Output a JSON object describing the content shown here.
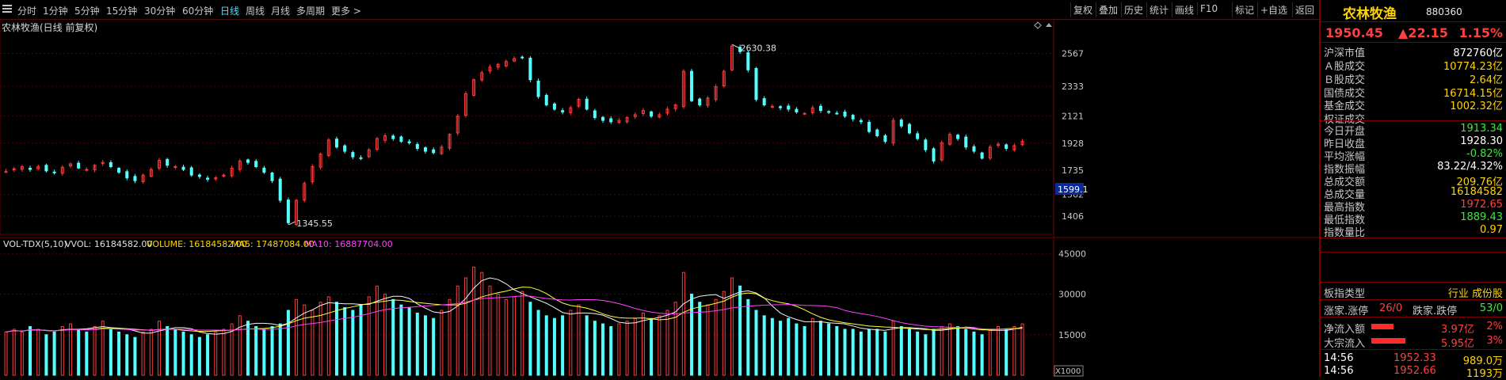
{
  "toolbar": {
    "periods": [
      "分时",
      "1分钟",
      "5分钟",
      "15分钟",
      "30分钟",
      "60分钟",
      "日线",
      "周线",
      "月线",
      "多周期",
      "更多 >"
    ],
    "active_period": "日线",
    "right_buttons": [
      "复权",
      "叠加",
      "历史",
      "统计",
      "画线",
      "F10",
      "标记",
      "+自选",
      "返回"
    ],
    "left_icon": "menu-icon"
  },
  "chart": {
    "title": "农林牧渔(日线 前复权)",
    "max_label": "2630.38",
    "min_label": "1345.55",
    "cursor_price": "1599.1",
    "price_ticks": [
      "2567",
      "2333",
      "2121",
      "1928",
      "1735",
      "1562",
      "1406"
    ],
    "vol_ticks": [
      "45000",
      "30000",
      "15000"
    ],
    "vol_unit": "X1000",
    "vol_info": {
      "name": "VOL-TDX(5,10)",
      "vvol": "VVOL: 16184582.00",
      "volume": "VOLUME: 16184582.00",
      "ma5": "MA5: 17487084.00",
      "ma10": "MA10: 16887704.00"
    },
    "colors": {
      "up": "#ff3b3b",
      "down": "#54ffff",
      "ma5": "#f4f4f4",
      "ma10": "#ffff3c",
      "ma20": "#ff40ff",
      "grid": "#5a0000"
    }
  },
  "chart_data": {
    "type": "candlestick",
    "title": "农林牧渔(日线 前复权)",
    "close_path": [
      1725,
      1745,
      1760,
      1740,
      1760,
      1730,
      1720,
      1755,
      1780,
      1750,
      1740,
      1770,
      1790,
      1760,
      1720,
      1680,
      1660,
      1700,
      1740,
      1805,
      1770,
      1760,
      1740,
      1700,
      1690,
      1670,
      1680,
      1700,
      1750,
      1800,
      1790,
      1760,
      1720,
      1660,
      1520,
      1360,
      1520,
      1640,
      1760,
      1850,
      1950,
      1900,
      1870,
      1830,
      1820,
      1880,
      1960,
      1980,
      1960,
      1940,
      1930,
      1890,
      1870,
      1860,
      1900,
      1990,
      2120,
      2280,
      2380,
      2430,
      2470,
      2490,
      2510,
      2530,
      2540,
      2380,
      2260,
      2200,
      2170,
      2150,
      2180,
      2240,
      2170,
      2110,
      2090,
      2080,
      2090,
      2110,
      2130,
      2160,
      2120,
      2130,
      2170,
      2200,
      2440,
      2230,
      2200,
      2250,
      2330,
      2440,
      2620,
      2580,
      2450,
      2240,
      2200,
      2190,
      2180,
      2170,
      2150,
      2140,
      2180,
      2160,
      2150,
      2140,
      2120,
      2100,
      2080,
      2010,
      1980,
      1940,
      2090,
      2050,
      2000,
      1960,
      1880,
      1800,
      1930,
      1990,
      1960,
      1900,
      1870,
      1820,
      1900,
      1920,
      1890,
      1910,
      1940
    ],
    "volume_path": [
      16,
      17,
      16,
      18,
      17,
      15,
      16,
      18,
      19,
      17,
      16,
      18,
      20,
      17,
      16,
      15,
      14,
      16,
      17,
      20,
      18,
      17,
      16,
      15,
      14,
      15,
      16,
      17,
      19,
      22,
      20,
      18,
      17,
      18,
      19,
      24,
      28,
      26,
      24,
      27,
      29,
      27,
      25,
      24,
      26,
      29,
      33,
      30,
      28,
      26,
      25,
      23,
      22,
      21,
      24,
      28,
      33,
      36,
      40,
      38,
      33,
      30,
      28,
      29,
      31,
      27,
      24,
      22,
      21,
      22,
      24,
      26,
      22,
      20,
      19,
      18,
      19,
      20,
      21,
      23,
      21,
      22,
      24,
      27,
      38,
      30,
      27,
      26,
      28,
      31,
      36,
      33,
      28,
      24,
      22,
      21,
      20,
      21,
      19,
      18,
      21,
      20,
      19,
      18,
      17,
      17,
      16,
      17,
      17,
      16,
      20,
      18,
      17,
      16,
      15,
      17,
      18,
      19,
      18,
      17,
      16,
      15,
      17,
      18,
      17,
      18,
      19
    ],
    "vol_ma5": 17487084.0,
    "vol_ma10": 16887704.0,
    "highest": 2630.38,
    "lowest": 1345.55,
    "ylim": [
      1345.55,
      2630.38
    ]
  },
  "side": {
    "name": "农林牧渔",
    "code": "880360",
    "price": "1950.45",
    "change": "▲22.15",
    "pct": "1.15%",
    "rows": [
      {
        "label": "沪深市值",
        "value": "872760亿",
        "cls": "white"
      },
      {
        "label": "Ａ股成交",
        "value": "10774.23亿",
        "cls": "yel"
      },
      {
        "label": "Ｂ股成交",
        "value": "2.64亿",
        "cls": "yel"
      },
      {
        "label": "国债成交",
        "value": "16714.15亿",
        "cls": "yel"
      },
      {
        "label": "基金成交",
        "value": "1002.32亿",
        "cls": "yel"
      },
      {
        "label": "权证成交",
        "value": "",
        "cls": "yel"
      },
      {
        "label": "今日开盘",
        "value": "1913.34",
        "cls": "green"
      },
      {
        "label": "昨日收盘",
        "value": "1928.30",
        "cls": "white"
      },
      {
        "label": "平均涨幅",
        "value": "-0.82%",
        "cls": "green"
      },
      {
        "label": "指数振幅",
        "value": "83.22/4.32%",
        "cls": "white"
      },
      {
        "label": "总成交额",
        "value": "209.76亿",
        "cls": "yel"
      },
      {
        "label": "总成交量",
        "value": "16184582",
        "cls": "yel"
      },
      {
        "label": "最高指数",
        "value": "1972.65",
        "cls": "red"
      },
      {
        "label": "最低指数",
        "value": "1889.43",
        "cls": "green"
      },
      {
        "label": "指数量比",
        "value": "0.97",
        "cls": "yel"
      }
    ],
    "type_label": "板指类型",
    "type_value": "行业 成份股",
    "up_label": "涨家.涨停",
    "up_value": "26/0",
    "down_label": "跌家.跌停",
    "down_value": "53/0",
    "net_inflow_label": "净流入额",
    "net_inflow_value": "3.97亿",
    "net_inflow_pct": "2%",
    "net_inflow_fill": 0.45,
    "block_inflow_label": "大宗流入",
    "block_inflow_value": "5.95亿",
    "block_inflow_pct": "3%",
    "block_inflow_fill": 0.7,
    "ticks": [
      {
        "time": "14:56",
        "price": "1952.33",
        "vol": "989.0万"
      },
      {
        "time": "14:56",
        "price": "1952.66",
        "vol": "1193万"
      }
    ]
  }
}
